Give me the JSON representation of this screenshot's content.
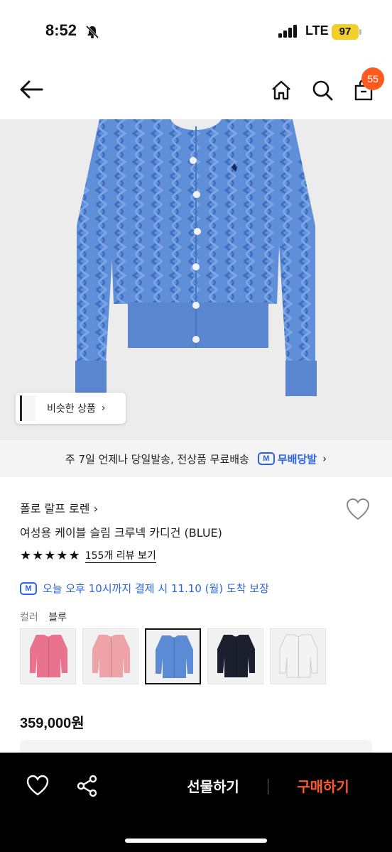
{
  "status_bar": {
    "time": "8:52",
    "network": "LTE",
    "battery": "97"
  },
  "header": {
    "cart_count": "55",
    "icons": [
      "back-arrow-icon",
      "home-icon",
      "search-icon",
      "cart-icon"
    ]
  },
  "product_image": {
    "similar_label": "비슷한 상품",
    "similar_chevron": "›"
  },
  "shipping_banner": {
    "text": "주 7일 언제나 당일발송, 전상품 무료배송",
    "badge": "M",
    "free_label": "무배당발",
    "chevron": "›"
  },
  "product": {
    "brand": "폴로 랄프 로렌 ›",
    "name": "여성용 케이블 슬림 크루넥 카디건 (BLUE)",
    "stars": "★★★★★",
    "review_link": "155개 리뷰 보기",
    "delivery_badge": "M",
    "delivery_text": "오늘 오후 10시까지 결제 시 11.10 (월) 도착 보장",
    "color_label": "컬러",
    "color_value": "블루",
    "price": "359,000원",
    "rating": 5
  },
  "swatches": [
    {
      "name": "pink",
      "color": "#e9738e",
      "selected": false
    },
    {
      "name": "light-pink",
      "color": "#eea3a8",
      "selected": false
    },
    {
      "name": "blue",
      "color": "#5c8bd6",
      "selected": true
    },
    {
      "name": "navy",
      "color": "#1b1f2e",
      "selected": false
    },
    {
      "name": "white",
      "color": "#f3f3f3",
      "selected": false
    }
  ],
  "bottom_bar": {
    "gift_label": "선물하기",
    "buy_label": "구매하기"
  },
  "colors": {
    "accent_orange": "#ff5a1f",
    "accent_blue": "#2a62e8",
    "cardigan_blue": "#5f8fd9"
  }
}
